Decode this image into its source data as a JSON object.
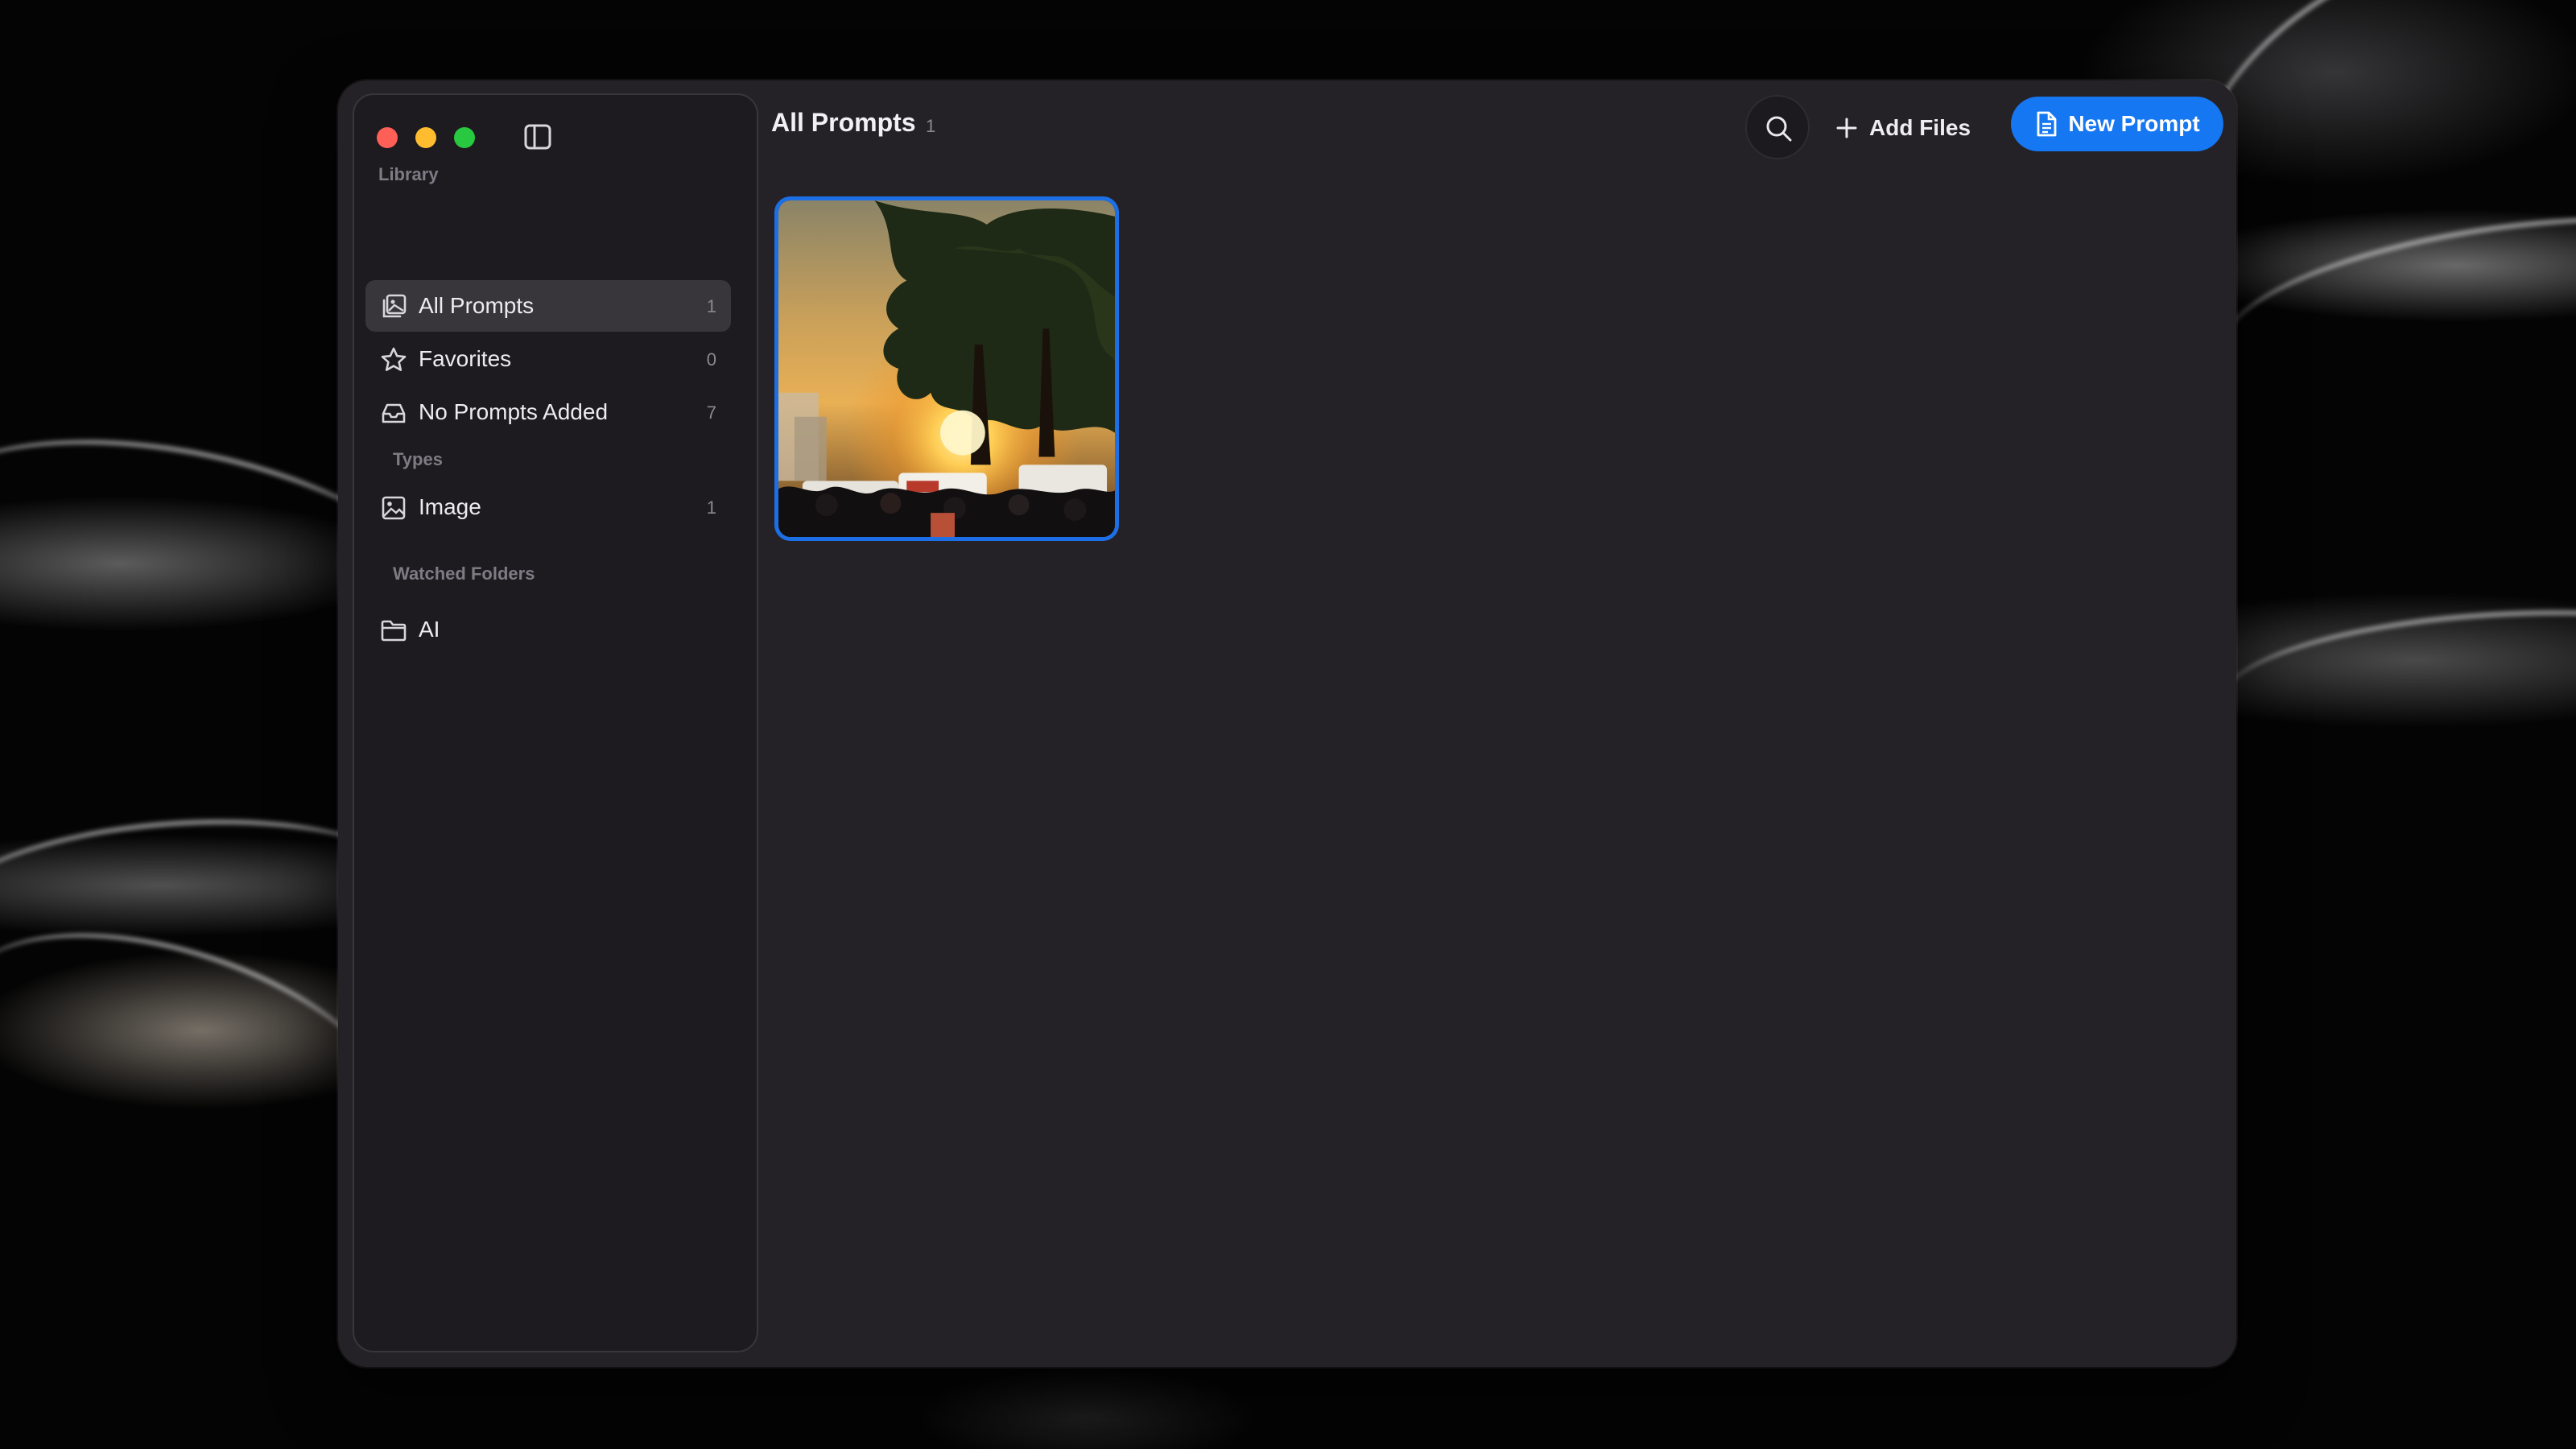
{
  "window": {
    "title": "All Prompts",
    "count": "1"
  },
  "sidebar": {
    "library_label": "Library",
    "types_label": "Types",
    "watched_label": "Watched Folders",
    "items": [
      {
        "label": "All Prompts",
        "count": "1",
        "icon": "gallery-icon"
      },
      {
        "label": "Favorites",
        "count": "0",
        "icon": "star-icon"
      },
      {
        "label": "No Prompts Added",
        "count": "7",
        "icon": "inbox-icon"
      }
    ],
    "types": [
      {
        "label": "Image",
        "count": "1",
        "icon": "image-icon"
      }
    ],
    "folders": [
      {
        "label": "AI",
        "icon": "folder-icon"
      }
    ]
  },
  "toolbar": {
    "add_files_label": "Add Files",
    "new_prompt_label": "New Prompt"
  },
  "gallery": {
    "items": [
      {
        "alt": "sunset through trees over a crowd",
        "selected": true
      }
    ]
  },
  "colors": {
    "accent": "#1677f2",
    "window_bg": "#242227",
    "sidebar_bg": "#1d1b20",
    "active_item": "#38353b"
  }
}
